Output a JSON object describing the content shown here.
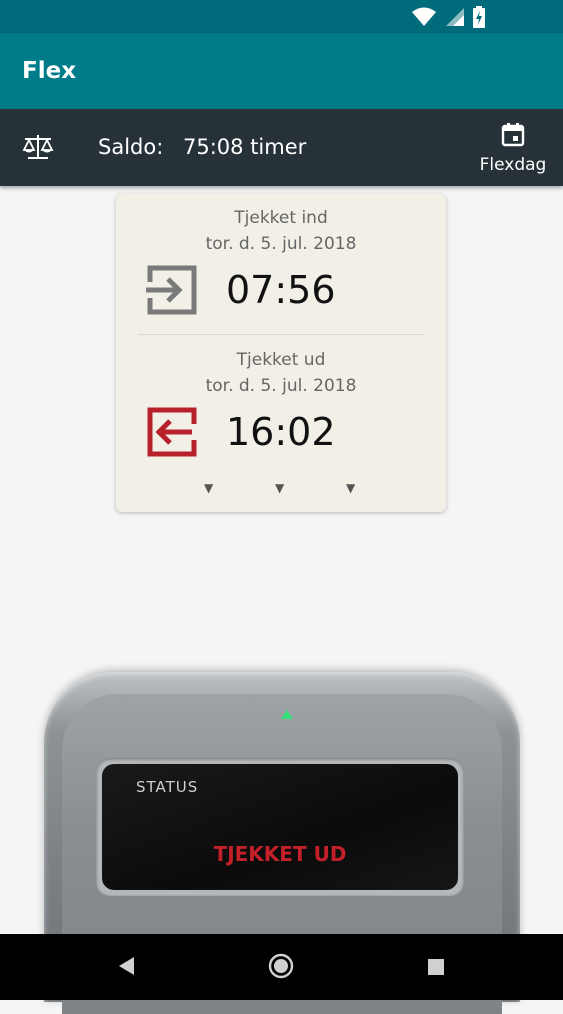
{
  "app": {
    "title": "Flex"
  },
  "toolbar": {
    "saldo_label": "Saldo:",
    "saldo_value": "75:08 timer",
    "flexdag_label": "Flexdag",
    "balance_icon": "balance-scale-icon",
    "calendar_icon": "calendar-icon"
  },
  "checkin": {
    "title": "Tjekket ind",
    "date": "tor. d. 5. jul. 2018",
    "time": "07:56",
    "icon": "login-icon"
  },
  "checkout": {
    "title": "Tjekket ud",
    "date": "tor. d. 5. jul. 2018",
    "time": "16:02",
    "icon": "logout-icon"
  },
  "device": {
    "status_label": "STATUS",
    "status_value": "TJEKKET UD"
  },
  "colors": {
    "status_bar": "#006b7a",
    "app_bar": "#007b89",
    "toolbar": "#263238",
    "checkout_red": "#c4202a",
    "led_green": "#35e07a"
  }
}
